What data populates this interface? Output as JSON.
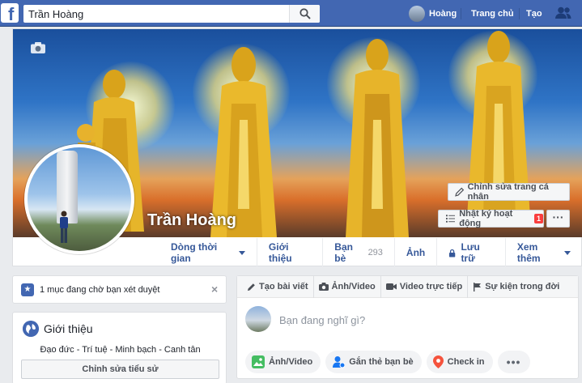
{
  "topbar": {
    "logo_letter": "f",
    "search_value": "Trần Hoàng",
    "user_name": "Hoàng",
    "home_label": "Trang chủ",
    "create_label": "Tạo"
  },
  "profile": {
    "name": "Trần Hoàng",
    "edit_profile_label": "Chỉnh sửa trang cá nhân",
    "activity_log_label": "Nhật ký hoạt động",
    "activity_badge": "1",
    "more_label": "···"
  },
  "tabs": {
    "timeline": "Dòng thời gian",
    "about": "Giới thiệu",
    "friends": "Bạn bè",
    "friends_count": "293",
    "photos": "Ảnh",
    "archive": "Lưu trữ",
    "more": "Xem thêm"
  },
  "pending": {
    "text": "1 mục đang chờ bạn xét duyệt",
    "close": "×"
  },
  "intro": {
    "title": "Giới thiệu",
    "bio": "Đạo đức - Trí tuệ - Minh bạch - Canh tân",
    "edit_bio_label": "Chỉnh sửa tiểu sử"
  },
  "composer": {
    "tabs": [
      "Tạo bài viết",
      "Ảnh/Video",
      "Video trực tiếp",
      "Sự kiện trong đời"
    ],
    "placeholder": "Bạn đang nghĩ gì?",
    "actions": [
      "Ảnh/Video",
      "Gắn thẻ bạn bè",
      "Check in"
    ],
    "more": "•••"
  },
  "colors": {
    "brand": "#4267b2",
    "link": "#365899",
    "badge": "#fa3e3e",
    "background": "#e9ebee"
  }
}
